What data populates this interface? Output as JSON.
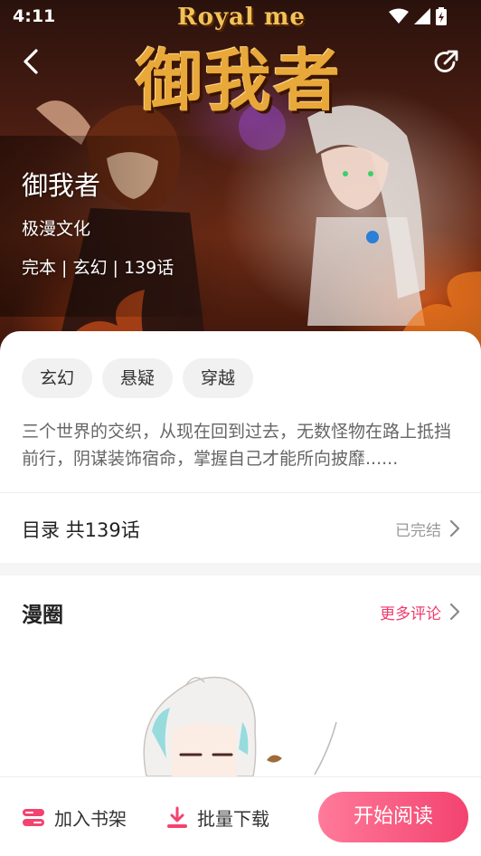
{
  "status_bar": {
    "time": "4:11"
  },
  "cover": {
    "logo_en": "Royal me",
    "logo_cn": "御我者",
    "title": "御我者",
    "author": "极漫文化",
    "meta": "完本 | 玄幻 | 139话"
  },
  "tags": [
    "玄幻",
    "悬疑",
    "穿越"
  ],
  "description": "三个世界的交织，从现在回到过去，无数怪物在路上抵挡前行，阴谋装饰宿命，掌握自己才能所向披靡......",
  "toc": {
    "label": "目录 共139话",
    "status": "已完结"
  },
  "circle": {
    "title": "漫圈",
    "more": "更多评论"
  },
  "bottom_bar": {
    "shelf": "加入书架",
    "download": "批量下载",
    "read": "开始阅读"
  },
  "colors": {
    "accent": "#f3436f",
    "accent_light": "#ff7a9a",
    "tag_bg": "#f1f1f1"
  },
  "icons": {
    "back": "chevron-left-icon",
    "share": "share-icon",
    "toc_arrow": "chevron-right-icon",
    "more_arrow": "chevron-right-icon",
    "shelf": "bookshelf-icon",
    "download": "download-icon"
  }
}
